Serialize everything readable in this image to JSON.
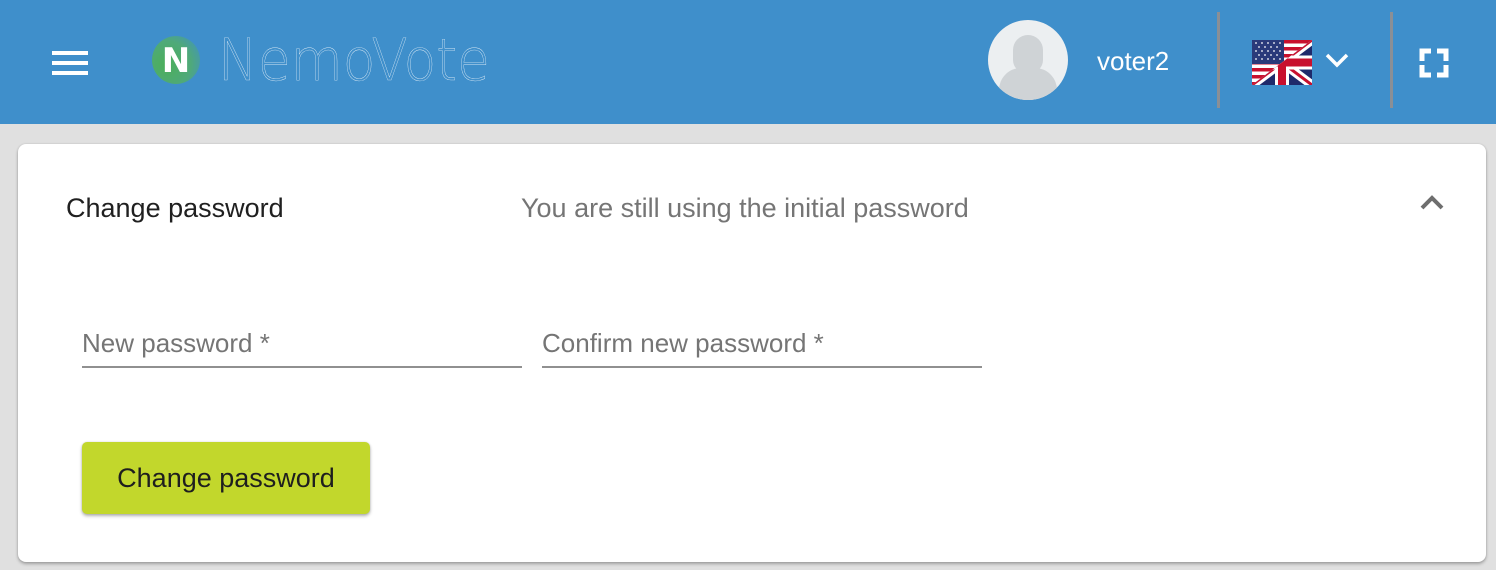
{
  "app": {
    "name": "NemoVote",
    "logo_letter": "N"
  },
  "header": {
    "menu_icon": "hamburger-menu-icon",
    "username": "voter2",
    "avatar_icon": "user-silhouette-icon",
    "language": {
      "selected": "English (US/UK)",
      "flag_icon": "us-uk-flag-icon",
      "dropdown_icon": "chevron-down-icon"
    },
    "fullscreen_icon": "fullscreen-icon"
  },
  "colors": {
    "header_bg": "#3f8fcb",
    "page_bg": "#e0e0e0",
    "button_accent": "#c2d72c",
    "logo_green": "#4caf5a"
  },
  "panel": {
    "title": "Change password",
    "description": "You are still using the initial password",
    "collapse_icon": "chevron-up-icon",
    "fields": [
      {
        "placeholder": "New password *",
        "value": ""
      },
      {
        "placeholder": "Confirm new password *",
        "value": ""
      }
    ],
    "submit_label": "Change password"
  }
}
